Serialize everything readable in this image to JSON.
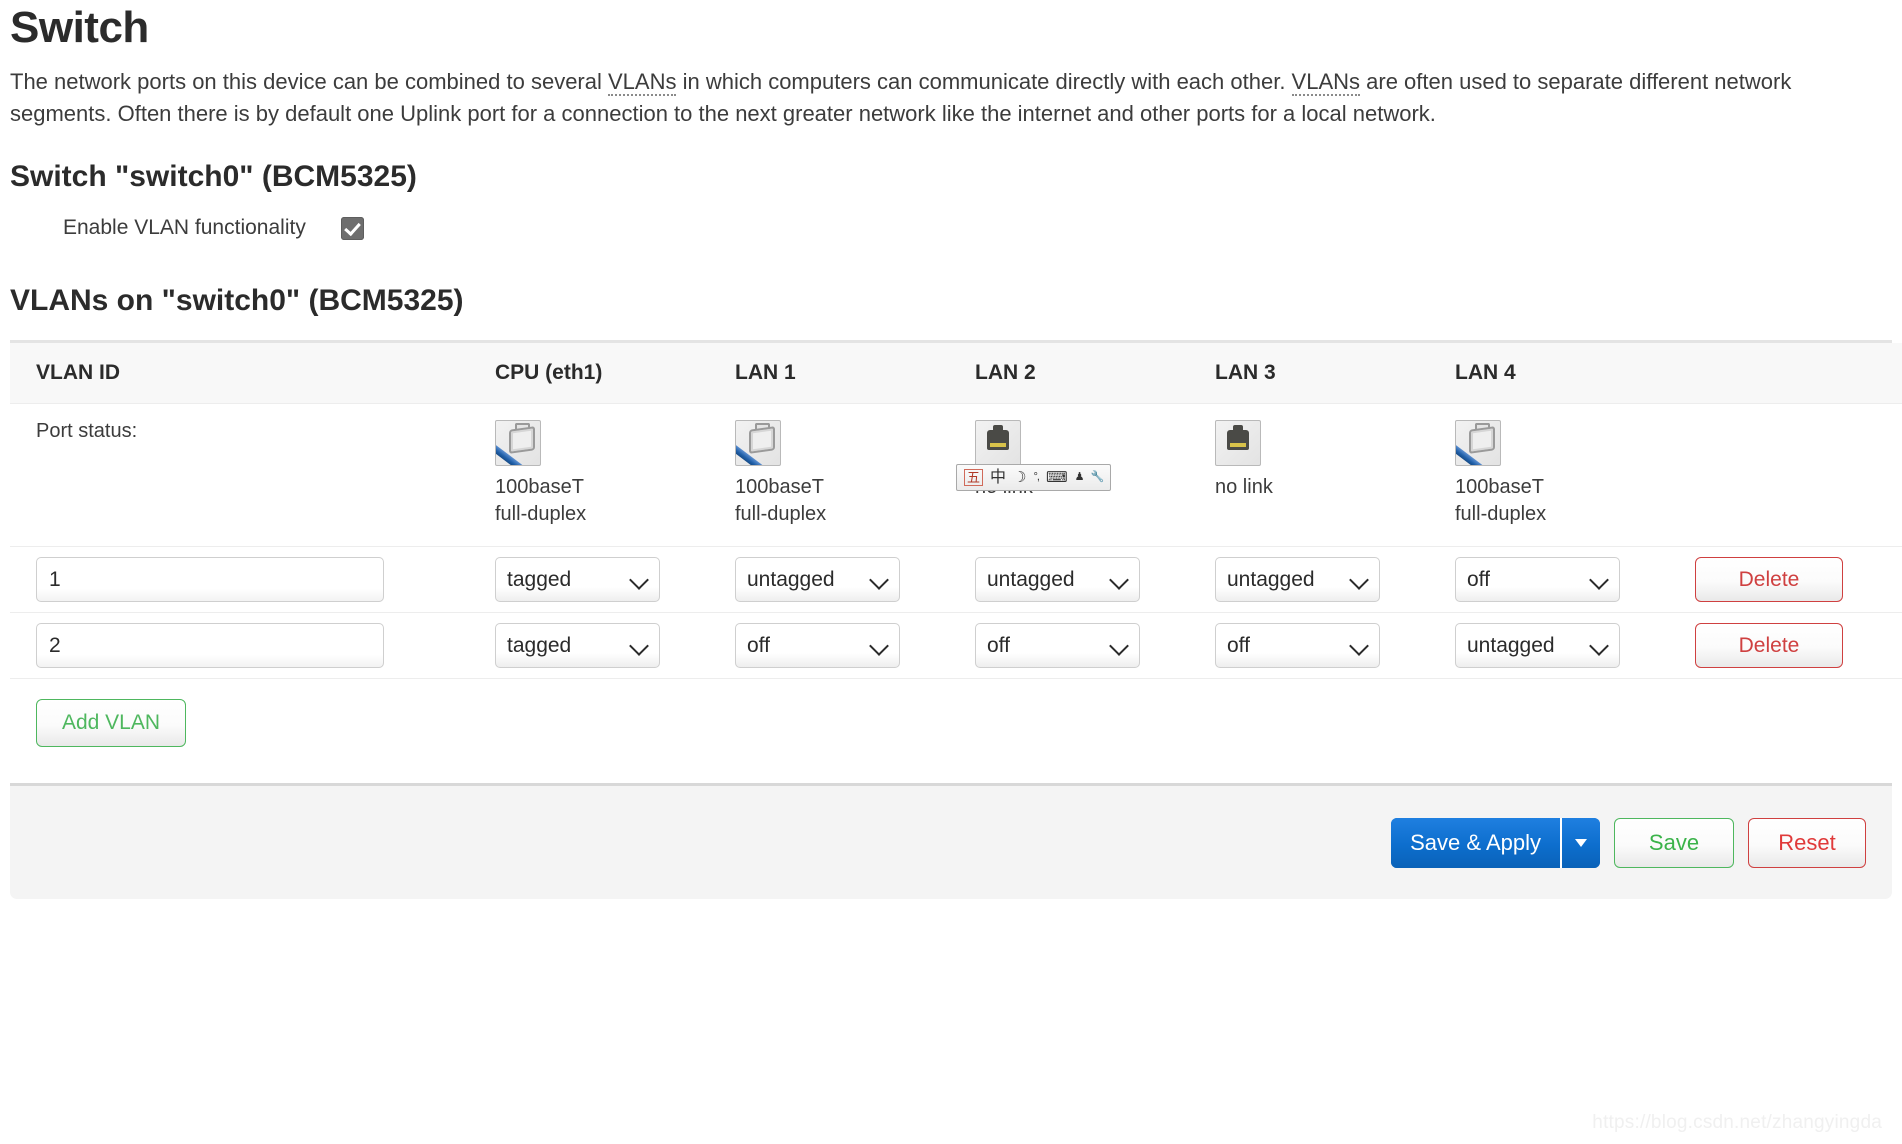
{
  "page": {
    "title": "Switch",
    "intro_part1": "The network ports on this device can be combined to several ",
    "intro_vlan1": "VLANs",
    "intro_part2": " in which computers can communicate directly with each other. ",
    "intro_vlan2": "VLANs",
    "intro_part3": " are often used to separate different network segments. Often there is by default one Uplink port for a connection to the next greater network like the internet and other ports for a local network."
  },
  "switch_section": {
    "title": "Switch \"switch0\" (BCM5325)",
    "enable_vlan_label": "Enable VLAN functionality",
    "enable_vlan_checked": "true"
  },
  "vlan_section": {
    "title": "VLANs on \"switch0\" (BCM5325)",
    "columns": [
      {
        "label": "VLAN ID"
      },
      {
        "label": "CPU (eth1)"
      },
      {
        "label": "LAN 1"
      },
      {
        "label": "LAN 2"
      },
      {
        "label": "LAN 3"
      },
      {
        "label": "LAN 4"
      },
      {
        "label": ""
      }
    ],
    "port_status_label": "Port status:",
    "port_status": [
      {
        "icon": "ethernet-connected-icon",
        "line1": "100baseT",
        "line2": "full-duplex"
      },
      {
        "icon": "ethernet-connected-icon",
        "line1": "100baseT",
        "line2": "full-duplex"
      },
      {
        "icon": "ethernet-nolink-icon",
        "line1": "no link",
        "line2": ""
      },
      {
        "icon": "ethernet-nolink-icon",
        "line1": "no link",
        "line2": ""
      },
      {
        "icon": "ethernet-connected-icon",
        "line1": "100baseT",
        "line2": "full-duplex"
      }
    ],
    "rows": [
      {
        "vlan_id": "1",
        "cpu": "tagged",
        "lan1": "untagged",
        "lan2": "untagged",
        "lan3": "untagged",
        "lan4": "off",
        "delete_label": "Delete"
      },
      {
        "vlan_id": "2",
        "cpu": "tagged",
        "lan1": "off",
        "lan2": "off",
        "lan3": "off",
        "lan4": "untagged",
        "delete_label": "Delete"
      }
    ],
    "port_options": [
      "off",
      "untagged",
      "tagged"
    ],
    "add_vlan_label": "Add VLAN"
  },
  "ime_toolbar": {
    "mode": "五",
    "lang": "中",
    "shape": "☽",
    "punct": "°,",
    "keyboard": "⌨",
    "softpad": "♟",
    "tools": "🔧"
  },
  "footer": {
    "save_apply_label": "Save & Apply",
    "dropdown_icon": "caret-down-icon",
    "save_label": "Save",
    "reset_label": "Reset"
  },
  "watermark": "https://blog.csdn.net/zhangyingda",
  "colors": {
    "primary_blue": "#0d6ecd",
    "green": "#4eb75e",
    "red": "#cf4040",
    "header_bg": "#f8f8f8",
    "footer_bg": "#f4f4f4"
  }
}
